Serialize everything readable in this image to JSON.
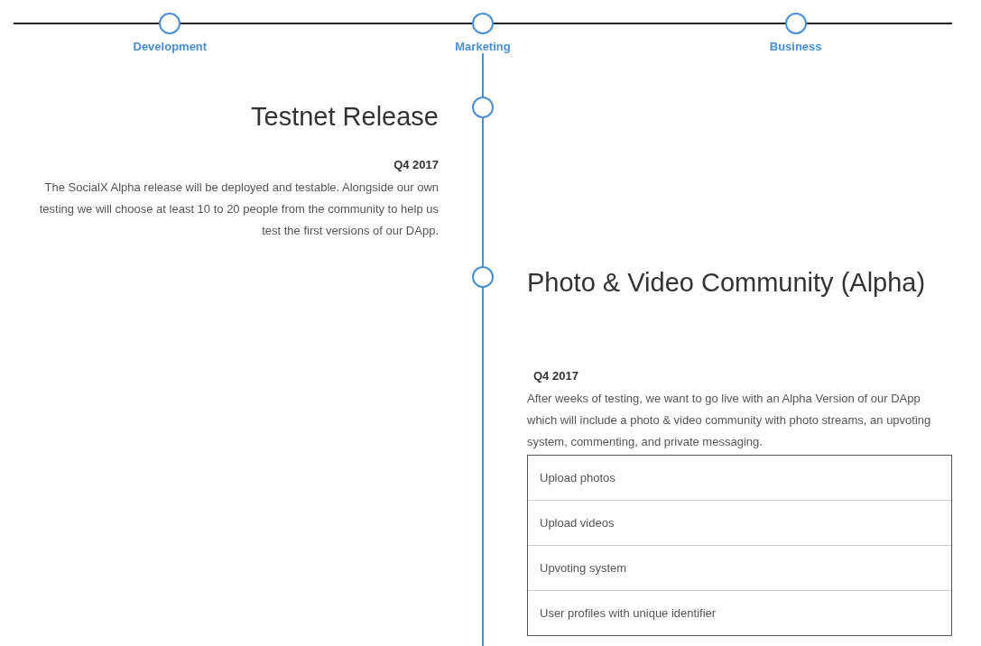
{
  "tabs": [
    {
      "label": "Development"
    },
    {
      "label": "Marketing"
    },
    {
      "label": "Business"
    }
  ],
  "events": [
    {
      "kind": "left",
      "title": "Testnet Release",
      "date": "Q4 2017",
      "text": "The SocialX Alpha release will be deployed and testable.  Alongside our own testing we will choose at least 10 to 20 people from the community to help us test the first versions of our DApp."
    },
    {
      "kind": "right",
      "title": "Photo & Video Community (Alpha)",
      "date": "Q4 2017",
      "text": "After weeks of testing, we want to go live with an Alpha Version of our DApp which will include a photo & video community with photo streams, an upvoting system, commenting, and private messaging.",
      "features": [
        "Upload photos",
        "Upload videos",
        "Upvoting system",
        "User profiles with unique identifier"
      ]
    }
  ]
}
